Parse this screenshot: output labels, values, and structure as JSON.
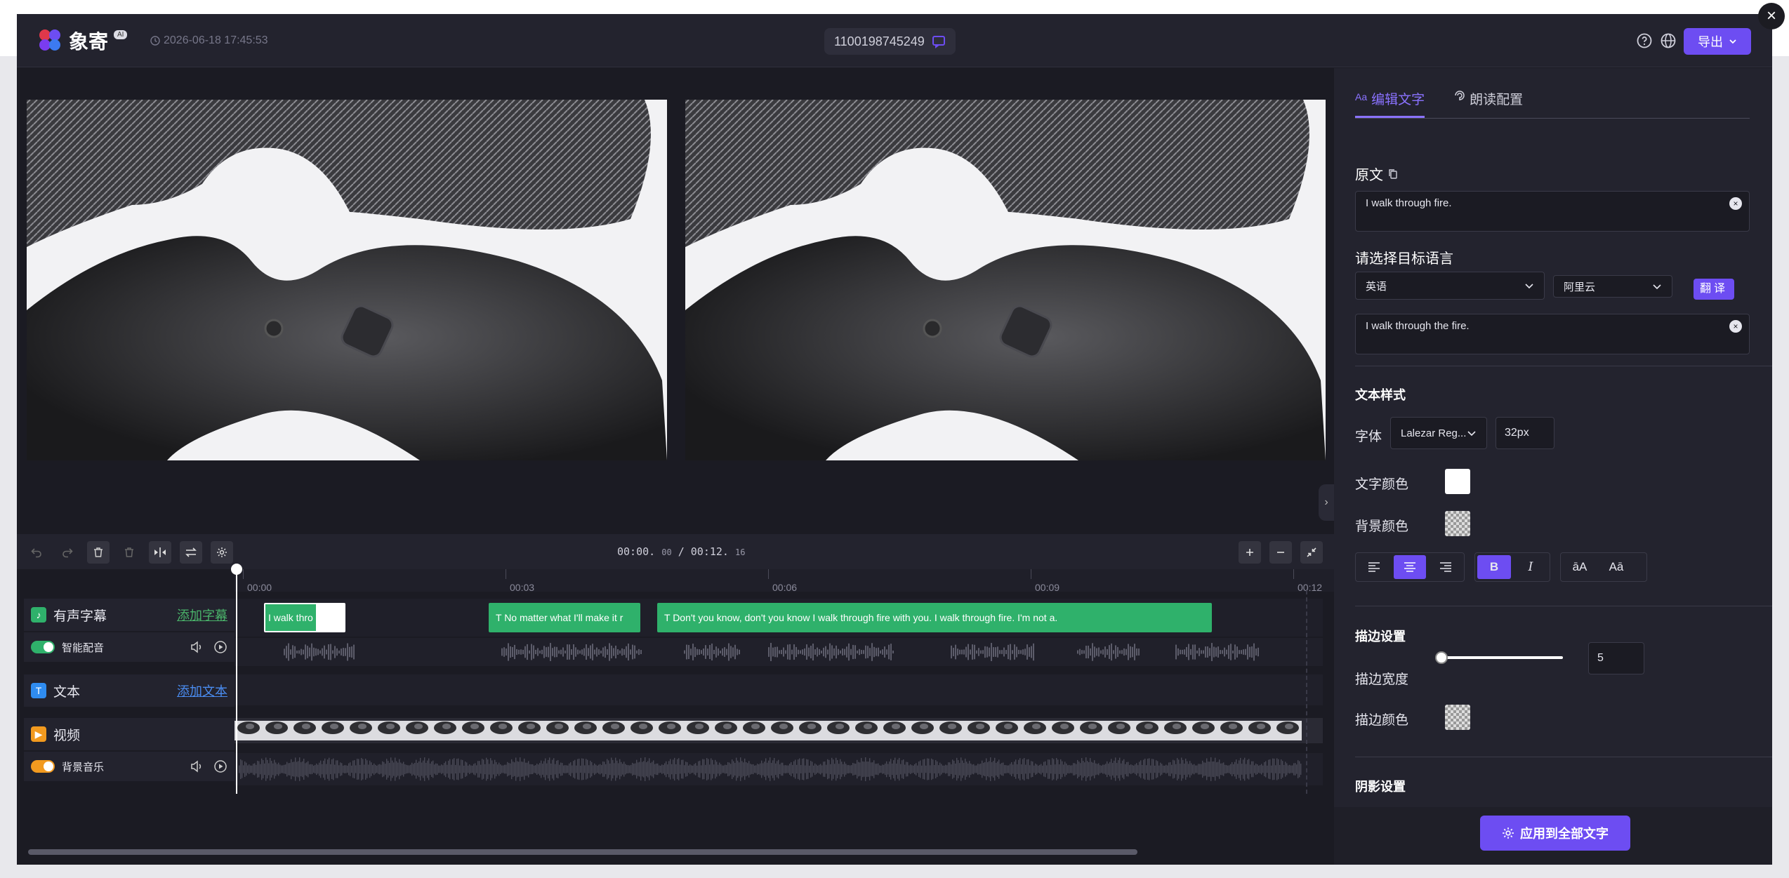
{
  "app": {
    "logo_text": "象寄",
    "logo_badge": "AI",
    "timestamp": "2026-06-18 17:45:53",
    "job_id": "1100198745249",
    "export_label": "导出"
  },
  "overlay": {
    "close": "×"
  },
  "player": {
    "time_current": "00:00.",
    "time_current_ms": "00",
    "time_separator": "/",
    "time_total": "00:12.",
    "time_total_ms": "16"
  },
  "ruler": {
    "ticks": [
      "00:00",
      "00:03",
      "00:06",
      "00:09",
      "00:12"
    ]
  },
  "tracks": {
    "subtitle": {
      "label": "有声字幕",
      "add": "添加字幕"
    },
    "voice": {
      "label": "智能配音"
    },
    "text": {
      "label": "文本",
      "add": "添加文本"
    },
    "video": {
      "label": "视频"
    },
    "music": {
      "label": "背景音乐"
    }
  },
  "clips": [
    {
      "text": "I walk thro"
    },
    {
      "text": "T  No matter what I'll make it r"
    },
    {
      "text": "T  Don't you know, don't you know I walk through fire with you. I walk through fire. I'm not a."
    }
  ],
  "panel": {
    "tab_edit": "编辑文字",
    "tab_edit_prefix": "Aa",
    "tab_read": "朗读配置",
    "original_label": "原文",
    "original_text": "I walk through fire.",
    "target_lang_label": "请选择目标语言",
    "lang_value": "英语",
    "engine_value": "阿里云",
    "translate_btn": "翻译",
    "translated_text": "I walk through the fire.",
    "style_title": "文本样式",
    "font_label": "字体",
    "font_value": "Lalezar Reg...",
    "font_size": "32px",
    "text_color_label": "文字颜色",
    "bg_color_label": "背景颜色",
    "stroke_title": "描边设置",
    "stroke_width_label": "描边宽度",
    "stroke_width_value": "5",
    "stroke_color_label": "描边颜色",
    "shadow_title": "阴影设置",
    "apply_all": "应用到全部文字",
    "case_upper": "āA",
    "case_title": "Aā",
    "bold": "B",
    "italic": "I"
  },
  "colors": {
    "accent": "#6d4df2",
    "clip_green": "#2fb16b",
    "toggle_green": "#2fb16b",
    "toggle_orange": "#f29a1f",
    "text_color": "#ffffff"
  }
}
